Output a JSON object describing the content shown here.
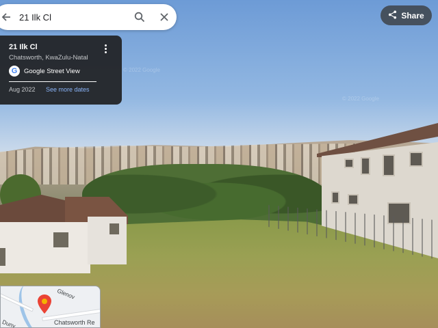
{
  "search": {
    "query": "21 Ilk Cl"
  },
  "share": {
    "label": "Share"
  },
  "card": {
    "title": "21 Ilk Cl",
    "subtitle": "Chatsworth, KwaZulu-Natal",
    "source": "Google Street View",
    "date": "Aug 2022",
    "more_dates_link": "See more dates"
  },
  "minimap": {
    "labels": [
      "Glenov",
      "Chatsworth Re",
      "Dunv"
    ]
  },
  "watermarks": [
    "© 2022 Google",
    "© 2022 Google"
  ],
  "colors": {
    "link": "#8ab4f8",
    "card_bg": "#202124",
    "pin": "#ea4335"
  },
  "icons": [
    "back-arrow-icon",
    "search-icon",
    "close-icon",
    "share-icon",
    "more-vert-icon",
    "google-logo-icon",
    "map-pin-icon"
  ]
}
